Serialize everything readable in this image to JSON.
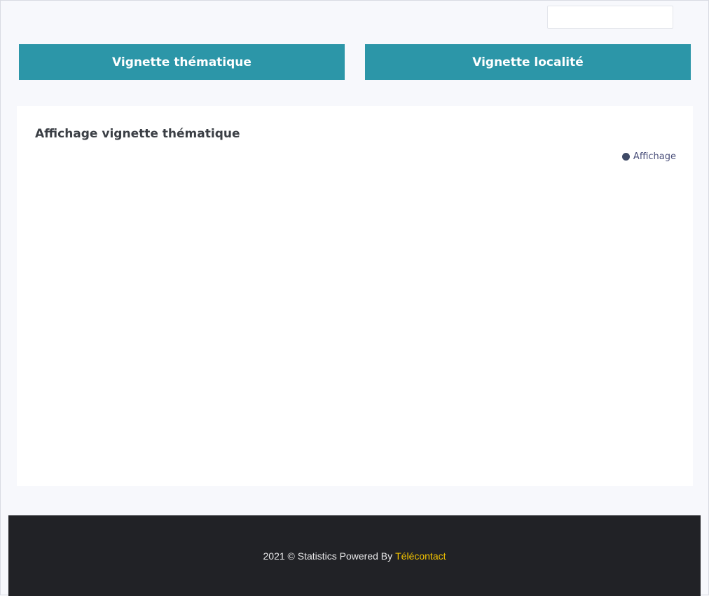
{
  "header": {
    "search_value": ""
  },
  "buttons": {
    "thematique_label": "Vignette thématique",
    "localite_label": "Vignette localité"
  },
  "card": {
    "title": "Affichage vignette thématique",
    "legend_label": "Affichage",
    "legend_color": "#3f4a66"
  },
  "chart_data": {
    "type": "line",
    "title": "Affichage vignette thématique",
    "series": [
      {
        "name": "Affichage",
        "values": []
      }
    ],
    "categories": [],
    "legend_position": "top-right"
  },
  "footer": {
    "text": "2021 © Statistics Powered By",
    "brand": "Télécontact",
    "brand_color": "#f2c300"
  },
  "colors": {
    "accent": "#2c96a8",
    "footer_bg": "#212226",
    "page_bg": "#f7f8fc"
  }
}
